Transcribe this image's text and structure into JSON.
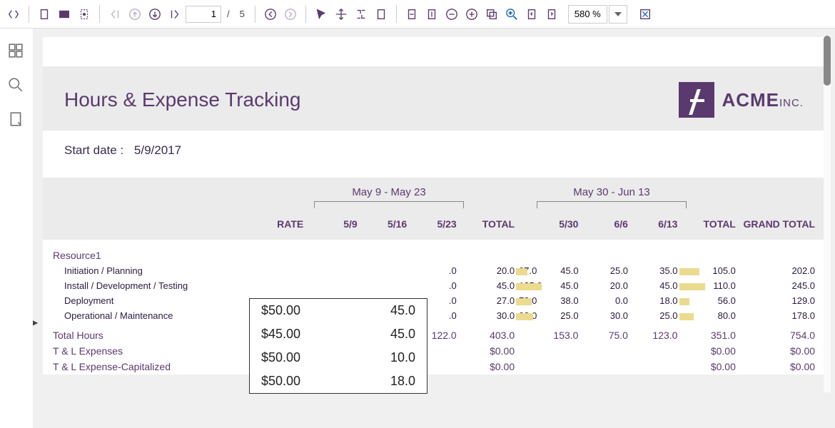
{
  "toolbar": {
    "page_current": "1",
    "page_total": "5",
    "page_sep": "/",
    "zoom": "580 %"
  },
  "report": {
    "title": "Hours & Expense Tracking",
    "logo_text": "ACME",
    "logo_suffix": "INC.",
    "start_date_label": "Start date :",
    "start_date": "5/9/2017"
  },
  "table": {
    "columns": {
      "rate": "RATE",
      "d1": "5/9",
      "d2": "5/16",
      "d3": "5/23",
      "total1": "TOTAL",
      "d4": "5/30",
      "d5": "6/6",
      "d6": "6/13",
      "total2": "TOTAL",
      "grand": "GRAND TOTAL"
    },
    "periods": {
      "p1": "May 9 - May 23",
      "p2": "May 30 - Jun 13"
    },
    "resource": "Resource1",
    "rows": [
      {
        "name": "Initiation / Planning",
        "d3": "20.0",
        "t1": "97.0",
        "d4": "45.0",
        "d5": "25.0",
        "d6": "35.0",
        "t2": "105.0",
        "gt": "202.0"
      },
      {
        "name": "Install / Development / Testing",
        "d3": "45.0",
        "t1": "135.0",
        "d4": "45.0",
        "d5": "20.0",
        "d6": "45.0",
        "t2": "110.0",
        "gt": "245.0"
      },
      {
        "name": "Deployment",
        "d3": "27.0",
        "t1": "73.0",
        "d4": "38.0",
        "d5": "0.0",
        "d6": "18.0",
        "t2": "56.0",
        "gt": "129.0"
      },
      {
        "name": "Operational / Maintenance",
        "d3": "30.0",
        "t1": "98.0",
        "d4": "25.0",
        "d5": "30.0",
        "d6": "25.0",
        "t2": "80.0",
        "gt": "178.0"
      }
    ],
    "summary": [
      {
        "name": "Total Hours",
        "d3": "122.0",
        "t1": "403.0",
        "d4": "153.0",
        "d5": "75.0",
        "d6": "123.0",
        "t2": "351.0",
        "gt": "754.0"
      },
      {
        "name": "T & L Expenses",
        "t1": "$0.00",
        "t2": "$0.00",
        "gt": "$0.00"
      },
      {
        "name": "T & L Expense-Capitalized",
        "t1": "$0.00",
        "t2": "$0.00",
        "gt": "$0.00"
      }
    ],
    "cut_col": ".0"
  },
  "tooltip": [
    {
      "rate": "$50.00",
      "val": "45.0"
    },
    {
      "rate": "$45.00",
      "val": "45.0"
    },
    {
      "rate": "$50.00",
      "val": "10.0"
    },
    {
      "rate": "$50.00",
      "val": "18.0"
    }
  ]
}
